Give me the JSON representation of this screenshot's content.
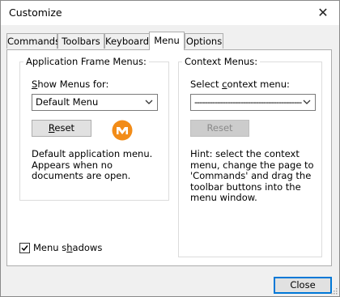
{
  "window": {
    "title": "Customize"
  },
  "tabs": [
    {
      "label": "Commands"
    },
    {
      "label": "Toolbars"
    },
    {
      "label": "Keyboard"
    },
    {
      "label": "Menu",
      "active": true
    },
    {
      "label": "Options"
    }
  ],
  "app_frame": {
    "legend": "Application Frame Menus:",
    "show_label_pre": "",
    "show_label_ul": "S",
    "show_label_post": "how Menus for:",
    "selected": "Default Menu",
    "reset_ul": "R",
    "reset_post": "eset",
    "description": "Default application menu. Appears when no documents are open."
  },
  "context": {
    "legend": "Context Menus:",
    "select_pre": "Select ",
    "select_ul": "c",
    "select_post": "ontext menu:",
    "selected": "------------------------------------------",
    "reset": "Reset",
    "hint": "Hint: select the context menu, change the page to 'Commands' and drag the toolbar buttons into the menu window."
  },
  "shadows": {
    "pre": "Menu s",
    "ul": "h",
    "post": "adows",
    "checked": true
  },
  "footer": {
    "close": "Close"
  },
  "colors": {
    "accent": "#0078d7",
    "logo": "#f28c18"
  },
  "icons": {
    "close": "close-icon",
    "logo": "app-logo-icon",
    "chevron": "chevron-down-icon",
    "check": "check-icon"
  }
}
